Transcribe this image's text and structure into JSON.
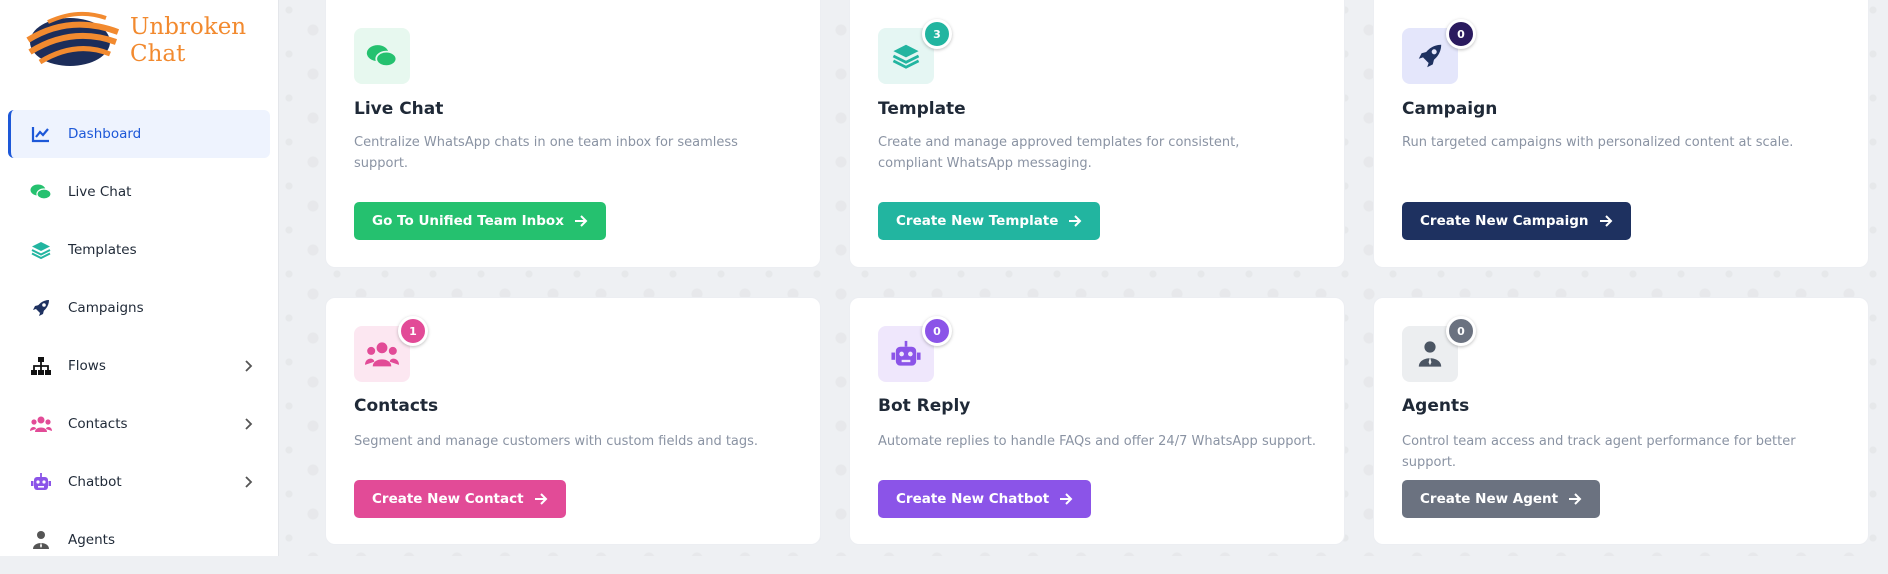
{
  "brand": {
    "line1": "Unbroken",
    "line2": "Chat"
  },
  "sidebar": {
    "items": [
      {
        "label": "Dashboard",
        "icon": "chart-line-icon",
        "active": true
      },
      {
        "label": "Live Chat",
        "icon": "comments-icon"
      },
      {
        "label": "Templates",
        "icon": "layers-icon"
      },
      {
        "label": "Campaigns",
        "icon": "rocket-icon"
      },
      {
        "label": "Flows",
        "icon": "sitemap-icon",
        "expandable": true
      },
      {
        "label": "Contacts",
        "icon": "users-icon",
        "expandable": true
      },
      {
        "label": "Chatbot",
        "icon": "robot-icon",
        "expandable": true
      },
      {
        "label": "Agents",
        "icon": "agent-icon"
      }
    ]
  },
  "cards": {
    "live_chat": {
      "title": "Live Chat",
      "desc": "Centralize WhatsApp chats in one team inbox for seamless support.",
      "button": "Go To Unified Team Inbox",
      "color": "#25c16f"
    },
    "template": {
      "title": "Template",
      "desc": "Create and manage approved templates for consistent, compliant WhatsApp messaging.",
      "button": "Create New Template",
      "badge": "3",
      "color": "#22b5a0"
    },
    "campaign": {
      "title": "Campaign",
      "desc": "Run targeted campaigns with personalized content at scale.",
      "button": "Create New Campaign",
      "badge": "0",
      "color": "#1e3160"
    },
    "contacts": {
      "title": "Contacts",
      "desc": "Segment and manage customers with custom fields and tags.",
      "button": "Create New Contact",
      "badge": "1",
      "color": "#e24b97"
    },
    "bot_reply": {
      "title": "Bot Reply",
      "desc": "Automate replies to handle FAQs and offer 24/7 WhatsApp support.",
      "button": "Create New Chatbot",
      "badge": "0",
      "color": "#8b54e8"
    },
    "agents": {
      "title": "Agents",
      "desc": "Control team access and track agent performance for better support.",
      "button": "Create New Agent",
      "badge": "0",
      "color": "#6b7280"
    }
  }
}
